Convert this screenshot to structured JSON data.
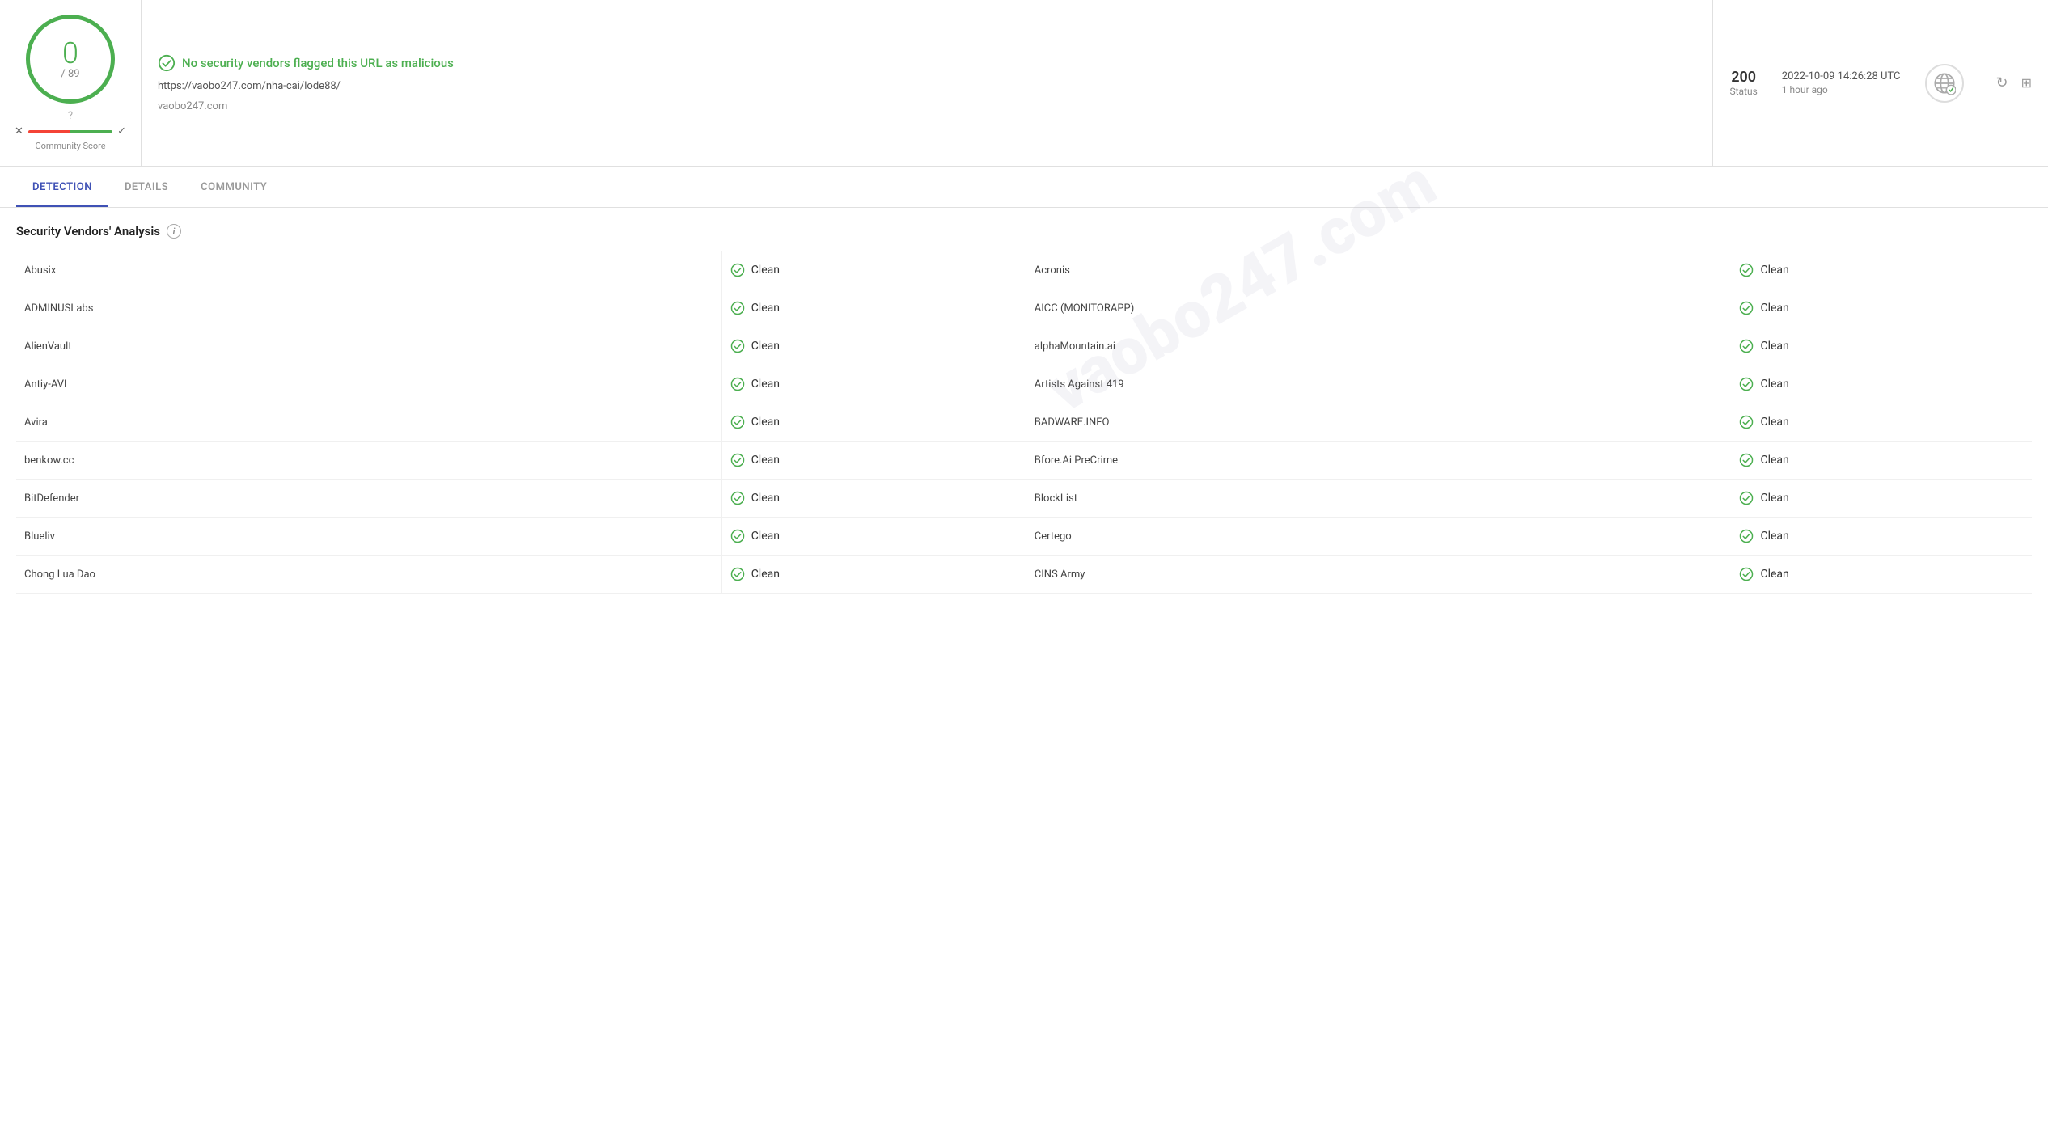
{
  "header": {
    "score": "0",
    "denom": "/ 89",
    "clean_message": "No security vendors flagged this URL as malicious",
    "url": "https://vaobo247.com/nha-cai/lode88/",
    "domain": "vaobo247.com",
    "status_code": "200",
    "status_label": "Status",
    "date": "2022-10-09 14:26:28 UTC",
    "ago": "1 hour ago",
    "community_score_label": "Community Score",
    "question": "?"
  },
  "tabs": [
    {
      "label": "DETECTION",
      "active": true
    },
    {
      "label": "DETAILS",
      "active": false
    },
    {
      "label": "COMMUNITY",
      "active": false
    }
  ],
  "section": {
    "title": "Security Vendors' Analysis"
  },
  "vendors": [
    {
      "left_name": "Abusix",
      "left_status": "Clean",
      "right_name": "Acronis",
      "right_status": "Clean"
    },
    {
      "left_name": "ADMINUSLabs",
      "left_status": "Clean",
      "right_name": "AICC (MONITORAPP)",
      "right_status": "Clean"
    },
    {
      "left_name": "AlienVault",
      "left_status": "Clean",
      "right_name": "alphaMountain.ai",
      "right_status": "Clean"
    },
    {
      "left_name": "Antiy-AVL",
      "left_status": "Clean",
      "right_name": "Artists Against 419",
      "right_status": "Clean"
    },
    {
      "left_name": "Avira",
      "left_status": "Clean",
      "right_name": "BADWARE.INFO",
      "right_status": "Clean"
    },
    {
      "left_name": "benkow.cc",
      "left_status": "Clean",
      "right_name": "Bfore.Ai PreCrime",
      "right_status": "Clean"
    },
    {
      "left_name": "BitDefender",
      "left_status": "Clean",
      "right_name": "BlockList",
      "right_status": "Clean"
    },
    {
      "left_name": "Blueliv",
      "left_status": "Clean",
      "right_name": "Certego",
      "right_status": "Clean"
    },
    {
      "left_name": "Chong Lua Dao",
      "left_status": "Clean",
      "right_name": "CINS Army",
      "right_status": "Clean"
    }
  ],
  "colors": {
    "green": "#4caf50",
    "blue": "#3f51b5",
    "red": "#f44336"
  }
}
